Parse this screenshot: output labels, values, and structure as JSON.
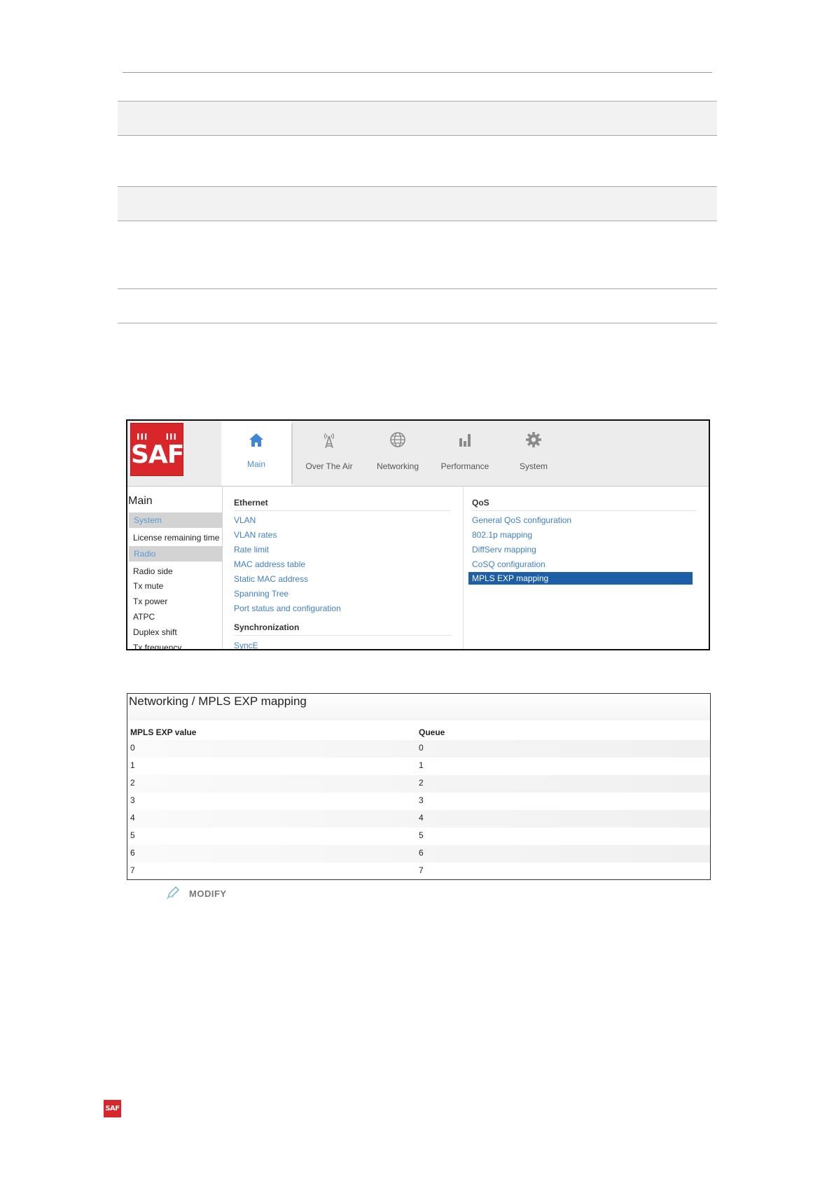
{
  "ui": {
    "logo_text": "SAF",
    "logo_bars": "III",
    "tabs": [
      {
        "label": "Main",
        "icon": "home-icon"
      },
      {
        "label": "Over The Air",
        "icon": "antenna-tower-icon"
      },
      {
        "label": "Networking",
        "icon": "globe-icon"
      },
      {
        "label": "Performance",
        "icon": "bar-chart-icon"
      },
      {
        "label": "System",
        "icon": "gear-icon"
      }
    ],
    "sidebar": {
      "title": "Main",
      "system_header": "System",
      "system_items": [
        "License remaining time"
      ],
      "radio_header": "Radio",
      "radio_items": [
        "Radio side",
        "Tx mute",
        "Tx power",
        "ATPC",
        "Duplex shift",
        "Tx frequency"
      ]
    },
    "menu": {
      "ethernet": {
        "title": "Ethernet",
        "items": [
          "VLAN",
          "VLAN rates",
          "Rate limit",
          "MAC address table",
          "Static MAC address",
          "Spanning Tree",
          "Port status and configuration"
        ]
      },
      "synchronization": {
        "title": "Synchronization",
        "items": [
          "SyncE"
        ]
      },
      "qos": {
        "title": "QoS",
        "items": [
          "General QoS configuration",
          "802.1p mapping",
          "DiffServ mapping",
          "CoSQ configuration",
          "MPLS EXP mapping"
        ],
        "selected": "MPLS EXP mapping"
      }
    },
    "colors": {
      "brand_red": "#d9262b",
      "link_blue": "#3f7fc4",
      "selected_bg": "#1c5fa8",
      "active_tab": "#4a8fd6"
    }
  },
  "mapping_page": {
    "title": "Networking / MPLS EXP mapping",
    "col_value": "MPLS EXP value",
    "col_queue": "Queue",
    "rows": [
      {
        "value": "0",
        "queue": "0"
      },
      {
        "value": "1",
        "queue": "1"
      },
      {
        "value": "2",
        "queue": "2"
      },
      {
        "value": "3",
        "queue": "3"
      },
      {
        "value": "4",
        "queue": "4"
      },
      {
        "value": "5",
        "queue": "5"
      },
      {
        "value": "6",
        "queue": "6"
      },
      {
        "value": "7",
        "queue": "7"
      }
    ],
    "modify_label": "MODIFY",
    "modify_icon": "pencil-icon"
  },
  "footer": {
    "logo_text": "SAF"
  }
}
